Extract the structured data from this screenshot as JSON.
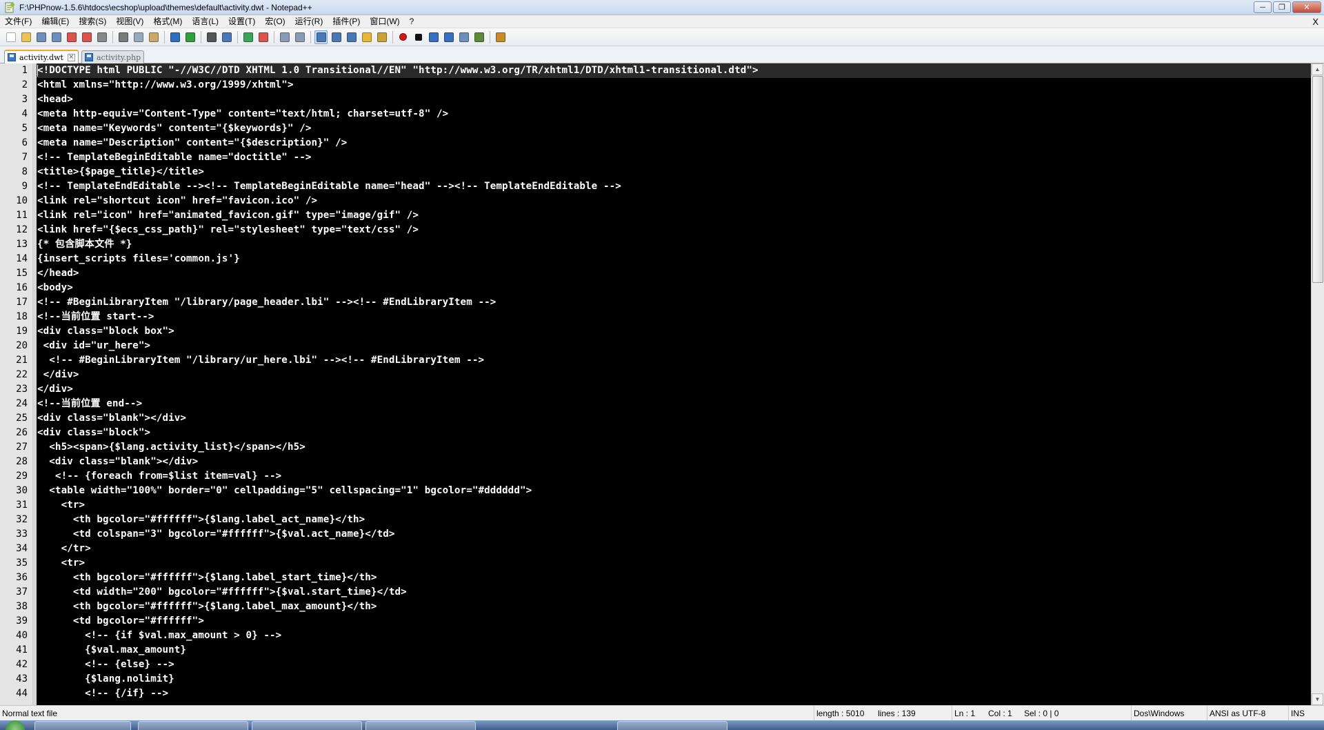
{
  "window": {
    "title": "F:\\PHPnow-1.5.6\\htdocs\\ecshop\\upload\\themes\\default\\activity.dwt - Notepad++",
    "minimize": "─",
    "maximize": "❐",
    "close": "✕"
  },
  "menu": {
    "items": [
      "文件(F)",
      "编辑(E)",
      "搜索(S)",
      "视图(V)",
      "格式(M)",
      "语言(L)",
      "设置(T)",
      "宏(O)",
      "运行(R)",
      "插件(P)",
      "窗口(W)",
      "?"
    ],
    "close_doc": "X"
  },
  "toolbar": {
    "buttons": [
      {
        "name": "new-file-icon",
        "color": "#ffffff"
      },
      {
        "name": "open-file-icon",
        "color": "#e8c25a"
      },
      {
        "name": "save-icon",
        "color": "#6f8fb8"
      },
      {
        "name": "save-all-icon",
        "color": "#6f8fb8"
      },
      {
        "name": "close-icon",
        "color": "#d9534f"
      },
      {
        "name": "close-all-icon",
        "color": "#d9534f"
      },
      {
        "name": "print-icon",
        "color": "#888888"
      },
      {
        "name": "cut-icon",
        "color": "#7a7a7a"
      },
      {
        "name": "copy-icon",
        "color": "#9aa8bb"
      },
      {
        "name": "paste-icon",
        "color": "#c9a86a"
      },
      {
        "name": "undo-icon",
        "color": "#2f6fbf"
      },
      {
        "name": "redo-icon",
        "color": "#2f9f3f"
      },
      {
        "name": "find-icon",
        "color": "#555555"
      },
      {
        "name": "replace-icon",
        "color": "#4a78b5"
      },
      {
        "name": "zoom-in-icon",
        "color": "#3aa55a"
      },
      {
        "name": "zoom-out-icon",
        "color": "#d9534f"
      },
      {
        "name": "sync-vertical-icon",
        "color": "#8a9bb3"
      },
      {
        "name": "sync-horizontal-icon",
        "color": "#8a9bb3"
      },
      {
        "name": "word-wrap-icon",
        "color": "#4a78b5"
      },
      {
        "name": "show-all-chars-icon",
        "color": "#4a78b5"
      },
      {
        "name": "indent-guide-icon",
        "color": "#4a78b5"
      },
      {
        "name": "user-language-icon",
        "color": "#e5b73b"
      },
      {
        "name": "doc-map-icon",
        "color": "#c9a23a"
      },
      {
        "name": "record-macro-icon",
        "color": "#d01818"
      },
      {
        "name": "stop-record-icon",
        "color": "#111111"
      },
      {
        "name": "play-macro-icon",
        "color": "#3a6fbf"
      },
      {
        "name": "play-multiple-icon",
        "color": "#3a6fbf"
      },
      {
        "name": "save-macro-icon",
        "color": "#6f8fb8"
      },
      {
        "name": "plugin-icon",
        "color": "#5c8a3a"
      },
      {
        "name": "launch-icon",
        "color": "#c98a2a"
      }
    ]
  },
  "tabs": [
    {
      "label": "activity.dwt",
      "active": true
    },
    {
      "label": "activity.php",
      "active": false
    }
  ],
  "editor": {
    "lines": [
      "<!DOCTYPE html PUBLIC \"-//W3C//DTD XHTML 1.0 Transitional//EN\" \"http://www.w3.org/TR/xhtml1/DTD/xhtml1-transitional.dtd\">",
      "<html xmlns=\"http://www.w3.org/1999/xhtml\">",
      "<head>",
      "<meta http-equiv=\"Content-Type\" content=\"text/html; charset=utf-8\" />",
      "<meta name=\"Keywords\" content=\"{$keywords}\" />",
      "<meta name=\"Description\" content=\"{$description}\" />",
      "<!-- TemplateBeginEditable name=\"doctitle\" -->",
      "<title>{$page_title}</title>",
      "<!-- TemplateEndEditable --><!-- TemplateBeginEditable name=\"head\" --><!-- TemplateEndEditable -->",
      "<link rel=\"shortcut icon\" href=\"favicon.ico\" />",
      "<link rel=\"icon\" href=\"animated_favicon.gif\" type=\"image/gif\" />",
      "<link href=\"{$ecs_css_path}\" rel=\"stylesheet\" type=\"text/css\" />",
      "{* 包含脚本文件 *}",
      "{insert_scripts files='common.js'}",
      "</head>",
      "<body>",
      "<!-- #BeginLibraryItem \"/library/page_header.lbi\" --><!-- #EndLibraryItem -->",
      "<!--当前位置 start-->",
      "<div class=\"block box\">",
      " <div id=\"ur_here\">",
      "  <!-- #BeginLibraryItem \"/library/ur_here.lbi\" --><!-- #EndLibraryItem -->",
      " </div>",
      "</div>",
      "<!--当前位置 end-->",
      "<div class=\"blank\"></div>",
      "<div class=\"block\">",
      "  <h5><span>{$lang.activity_list}</span></h5>",
      "  <div class=\"blank\"></div>",
      "   <!-- {foreach from=$list item=val} -->",
      "  <table width=\"100%\" border=\"0\" cellpadding=\"5\" cellspacing=\"1\" bgcolor=\"#dddddd\">",
      "    <tr>",
      "      <th bgcolor=\"#ffffff\">{$lang.label_act_name}</th>",
      "      <td colspan=\"3\" bgcolor=\"#ffffff\">{$val.act_name}</td>",
      "    </tr>",
      "    <tr>",
      "      <th bgcolor=\"#ffffff\">{$lang.label_start_time}</th>",
      "      <td width=\"200\" bgcolor=\"#ffffff\">{$val.start_time}</td>",
      "      <th bgcolor=\"#ffffff\">{$lang.label_max_amount}</th>",
      "      <td bgcolor=\"#ffffff\">",
      "        <!-- {if $val.max_amount > 0} -->",
      "        {$val.max_amount}",
      "        <!-- {else} -->",
      "        {$lang.nolimit}",
      "        <!-- {/if} -->"
    ]
  },
  "status": {
    "file_type": "Normal text file",
    "length": "length : 5010",
    "lines": "lines : 139",
    "ln": "Ln : 1",
    "col": "Col : 1",
    "sel": "Sel : 0 | 0",
    "eol": "Dos\\Windows",
    "encoding": "ANSI as UTF-8",
    "mode": "INS"
  },
  "colors": {
    "editor_bg": "#000000",
    "editor_fg": "#ffffff",
    "gutter_bg": "#e4e4e4",
    "active_tab_accent": "#f6a623"
  }
}
